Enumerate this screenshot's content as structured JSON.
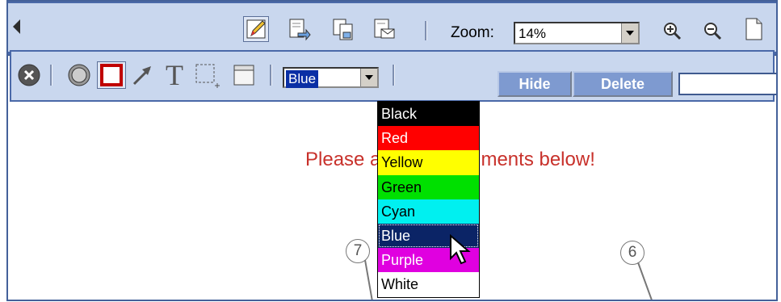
{
  "toolbar": {
    "zoom_label": "Zoom:",
    "zoom_value": "14%",
    "hide_label": "Hide",
    "delete_label": "Delete"
  },
  "color_select": {
    "selected": "Blue",
    "options": [
      {
        "label": "Black",
        "bg": "#000000",
        "fg": "#ffffff"
      },
      {
        "label": "Red",
        "bg": "#ff0000",
        "fg": "#ffffff"
      },
      {
        "label": "Yellow",
        "bg": "#ffff00",
        "fg": "#000000"
      },
      {
        "label": "Green",
        "bg": "#00e000",
        "fg": "#000000"
      },
      {
        "label": "Cyan",
        "bg": "#00f0f0",
        "fg": "#000000"
      },
      {
        "label": "Blue",
        "bg": "#0b2466",
        "fg": "#ffffff"
      },
      {
        "label": "Purple",
        "bg": "#e000e0",
        "fg": "#ffffff"
      },
      {
        "label": "White",
        "bg": "#ffffff",
        "fg": "#000000"
      }
    ]
  },
  "content": {
    "message": "Please add any comments below!",
    "callout_7": "7",
    "callout_6": "6"
  },
  "icons": [
    "collapse-arrow-icon",
    "edit-pencil-icon",
    "document-forward-icon",
    "copy-document-icon",
    "email-document-icon",
    "zoom-in-icon",
    "zoom-out-icon",
    "page-icon",
    "close-icon",
    "ellipse-tool-icon",
    "rectangle-tool-icon",
    "arrow-tool-icon",
    "text-tool-icon",
    "selection-tool-icon",
    "note-tool-icon"
  ]
}
